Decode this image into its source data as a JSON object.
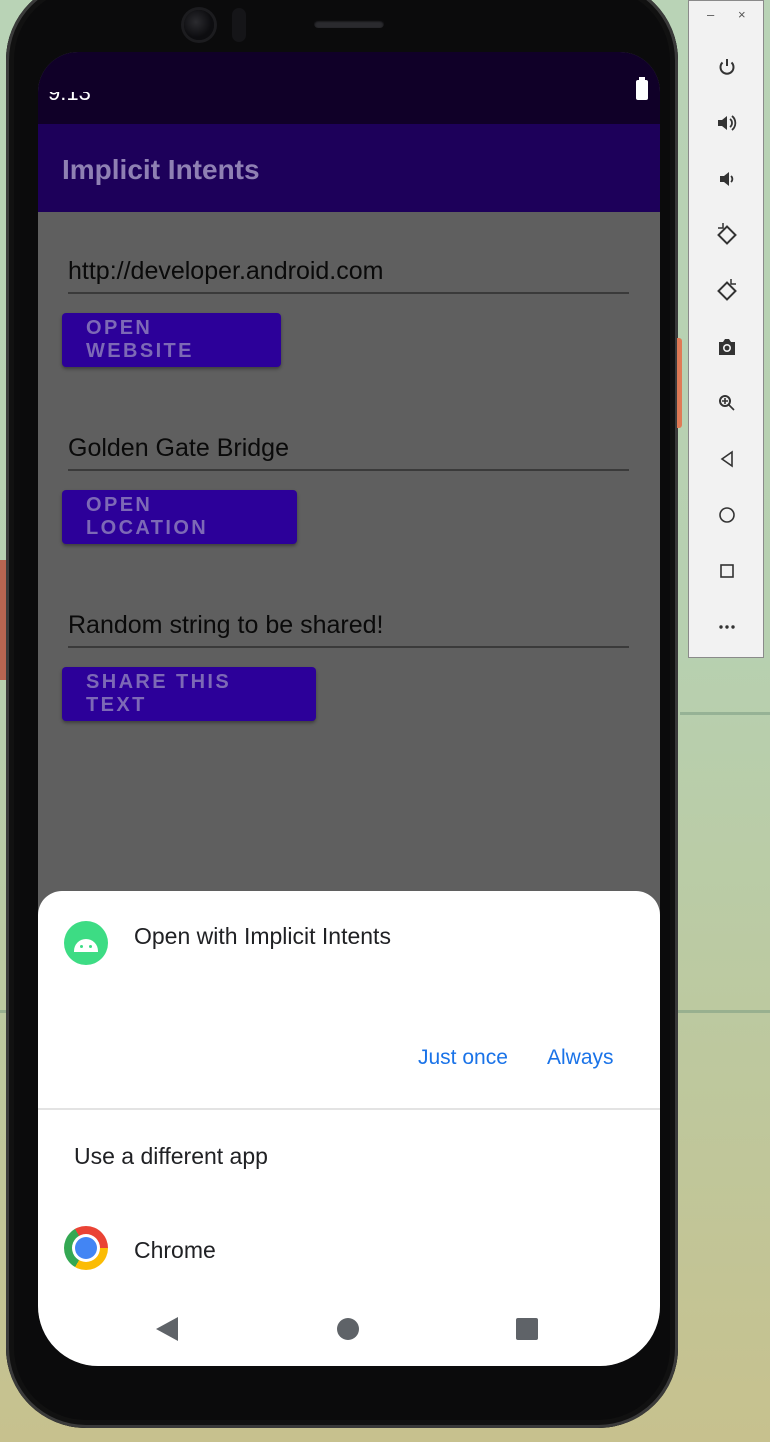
{
  "status_bar": {
    "time": "9:13"
  },
  "app_bar": {
    "title": "Implicit Intents"
  },
  "main": {
    "website_field": "http://developer.android.com",
    "website_button": "OPEN WEBSITE",
    "location_field": "Golden Gate Bridge",
    "location_button": "OPEN LOCATION",
    "share_field": "Random string to be shared!",
    "share_button": "SHARE THIS TEXT"
  },
  "sheet": {
    "title": "Open with Implicit Intents",
    "just_once": "Just once",
    "always": "Always",
    "alt_label": "Use a different app",
    "chrome_label": "Chrome"
  },
  "toolbar": {
    "minimize": "–",
    "close": "×",
    "items": [
      "power-icon",
      "volume-up-icon",
      "volume-down-icon",
      "rotate-left-icon",
      "rotate-right-icon",
      "camera-icon",
      "zoom-icon",
      "back-icon",
      "home-icon",
      "overview-icon",
      "more-icon"
    ]
  },
  "colors": {
    "status_bar": "#100028",
    "app_bar": "#1d005a",
    "button": "#2c0099",
    "accent_blue": "#1a73e8"
  }
}
